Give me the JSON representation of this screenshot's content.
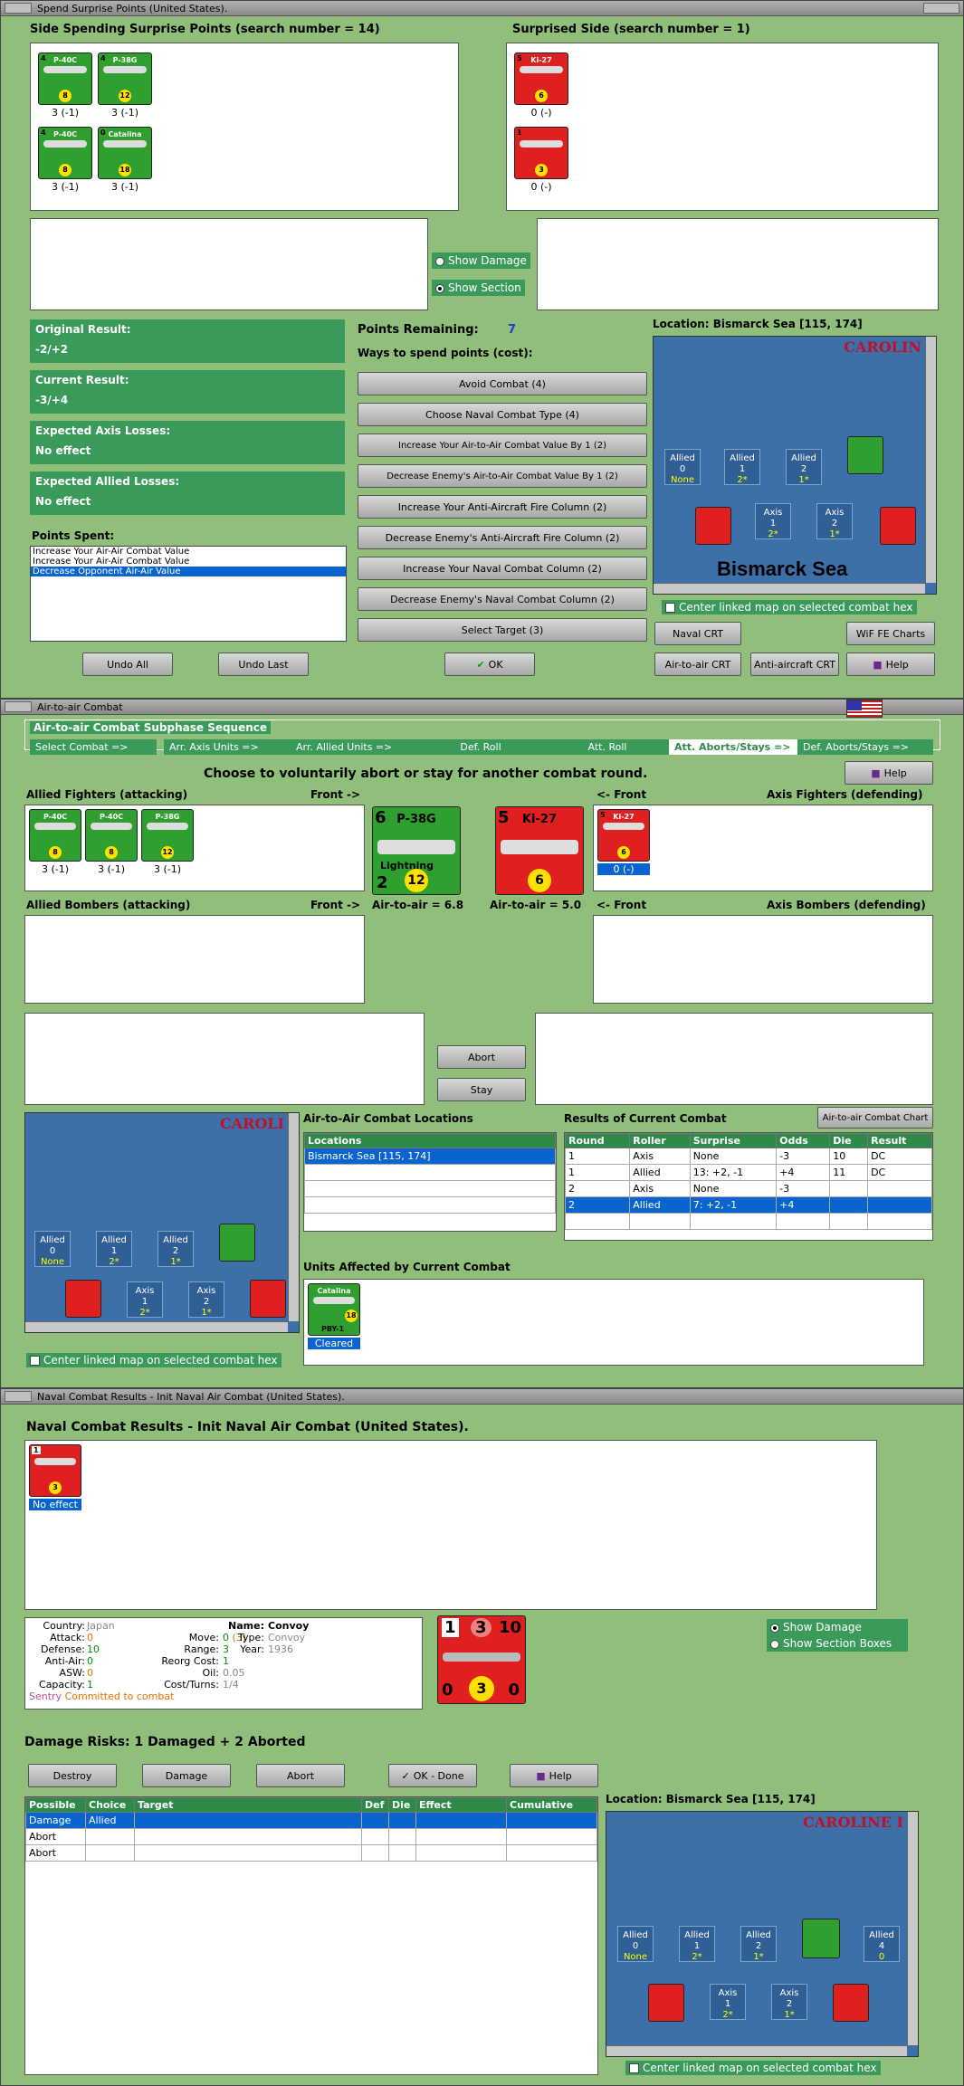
{
  "win1": {
    "title": "Spend Surprise Points (United States).",
    "side_header": "Side Spending Surprise Points (search number = 14)",
    "surprised_header": "Surprised Side (search number = 1)",
    "allied_counters": [
      {
        "name": "P-40C",
        "top": "4",
        "str": "8",
        "cap": "3 (-1)"
      },
      {
        "name": "P-38G",
        "top": "4",
        "str": "12",
        "cap": "3 (-1)"
      },
      {
        "name": "P-40C",
        "top": "4",
        "str": "8",
        "cap": "3 (-1)"
      },
      {
        "name": "Catalina",
        "top": "0",
        "str": "18",
        "cap": "3 (-1)"
      }
    ],
    "axis_counters": [
      {
        "name": "Ki-27",
        "top": "5",
        "str": "6",
        "cap": "0 (-)"
      },
      {
        "name": "",
        "top": "1",
        "str": "3",
        "cap": "0 (-)"
      }
    ],
    "show_damage": "Show Damage",
    "show_section": "Show Section",
    "original_result_label": "Original Result:",
    "original_result": "-2/+2",
    "current_result_label": "Current Result:",
    "current_result": "-3/+4",
    "axis_losses_label": "Expected Axis Losses:",
    "axis_losses": "No effect",
    "allied_losses_label": "Expected Allied Losses:",
    "allied_losses": "No effect",
    "points_spent_label": "Points Spent:",
    "points_spent": [
      "Increase Your Air-Air Combat Value",
      "Increase Your Air-Air Combat Value",
      "Decrease Opponent Air-Air Value"
    ],
    "points_remaining_label": "Points Remaining:",
    "points_remaining": "7",
    "ways_label": "Ways to spend points (cost):",
    "options": [
      "Avoid Combat (4)",
      "Choose Naval Combat Type (4)",
      "Increase Your Air-to-Air Combat Value By 1 (2)",
      "Decrease Enemy's Air-to-Air Combat Value By 1 (2)",
      "Increase Your Anti-Aircraft Fire Column (2)",
      "Decrease Enemy's Anti-Aircraft Fire Column (2)",
      "Increase Your Naval Combat Column (2)",
      "Decrease Enemy's Naval Combat Column (2)",
      "Select Target (3)"
    ],
    "location": "Location: Bismarck Sea [115, 174]",
    "map_caroline": "CAROLIN",
    "map_sea": "Bismarck Sea",
    "center_map": "Center linked map on selected combat hex",
    "undo_all": "Undo All",
    "undo_last": "Undo Last",
    "ok": "OK",
    "naval_crt": "Naval CRT",
    "wif_fe": "WiF FE Charts",
    "air_crt": "Air-to-air CRT",
    "aa_crt": "Anti-aircraft CRT",
    "help": "Help"
  },
  "map_hexes": [
    {
      "t": "Allied",
      "n": "0",
      "s": "None"
    },
    {
      "t": "Allied",
      "n": "1",
      "s": "2*"
    },
    {
      "t": "Allied",
      "n": "2",
      "s": "1*"
    },
    {
      "t": "Axis",
      "n": "1",
      "s": "2*"
    },
    {
      "t": "Axis",
      "n": "2",
      "s": "1*"
    }
  ],
  "win2": {
    "title": "Air-to-air Combat",
    "group": "Air-to-air Combat Subphase Sequence",
    "steps": [
      "Select Combat =>",
      "Arr. Axis Units =>",
      "Arr. Allied Units =>",
      "Def. Roll",
      "Att. Roll",
      "Att. Aborts/Stays =>",
      "Def. Aborts/Stays =>"
    ],
    "prompt": "Choose to voluntarily abort or stay for another combat round.",
    "help": "Help",
    "allied_fighters": "Allied Fighters (attacking)",
    "front_r": "Front ->",
    "front_l": "<- Front",
    "axis_fighters": "Axis Fighters (defending)",
    "allied_bombers": "Allied Bombers (attacking)",
    "axis_bombers": "Axis Bombers (defending)",
    "fighter_counters": [
      {
        "name": "P-40C",
        "str": "8",
        "cap": "3 (-1)"
      },
      {
        "name": "P-40C",
        "str": "8",
        "cap": "3 (-1)"
      },
      {
        "name": "P-38G",
        "str": "12",
        "cap": "3 (-1)"
      }
    ],
    "big_allied": {
      "top": "6",
      "name": "P-38G",
      "sub": "Lightning",
      "bot": "2",
      "str": "12"
    },
    "big_axis": {
      "top": "5",
      "name": "Ki-27",
      "str": "6"
    },
    "axis_small": {
      "name": "Ki-27",
      "top": "5",
      "str": "6",
      "cap": "0 (-)"
    },
    "aa_allied": "Air-to-air = 6.8",
    "aa_axis": "Air-to-air = 5.0",
    "abort": "Abort",
    "stay": "Stay",
    "map_caroline": "CAROLI",
    "locations_label": "Air-to-Air Combat Locations",
    "locations_header": "Locations",
    "locations": [
      "Bismarck Sea [115, 174]"
    ],
    "results_label": "Results of Current Combat",
    "chart_btn": "Air-to-air Combat Chart",
    "results_headers": [
      "Round",
      "Roller",
      "Surprise",
      "Odds",
      "Die",
      "Result"
    ],
    "results": [
      [
        "1",
        "Axis",
        "None",
        "-3",
        "10",
        "DC"
      ],
      [
        "1",
        "Allied",
        "13: +2, -1",
        "+4",
        "11",
        "DC"
      ],
      [
        "2",
        "Axis",
        "None",
        "-3",
        "",
        ""
      ],
      [
        "2",
        "Allied",
        "7: +2, -1",
        "+4",
        "",
        ""
      ]
    ],
    "affected_label": "Units Affected by Current Combat",
    "affected_unit": {
      "name": "Catalina",
      "str": "18",
      "sub": "PBY-1",
      "status": "Cleared"
    },
    "center_map": "Center linked map on selected combat hex"
  },
  "win3": {
    "title": "Naval Combat Results - Init Naval Air Combat (United States).",
    "header": "Naval Combat Results - Init Naval Air Combat (United States).",
    "unit_status": "No effect",
    "info": {
      "country_l": "Country:",
      "country": "Japan",
      "attack_l": "Attack:",
      "attack": "0",
      "defense_l": "Defense:",
      "defense": "10",
      "anti_air_l": "Anti-Air:",
      "anti_air": "0",
      "asw_l": "ASW:",
      "asw": "0",
      "capacity_l": "Capacity:",
      "capacity": "1",
      "sentry": "Sentry",
      "committed": "Committed to combat",
      "move_l": "Move:",
      "move": "0",
      "move_b": "(3)",
      "range_l": "Range:",
      "range": "3",
      "reorg_l": "Reorg Cost:",
      "reorg": "1",
      "oil_l": "Oil:",
      "oil": "0.05",
      "cost_l": "Cost/Turns:",
      "cost": "1/4",
      "name_l": "Name:",
      "name": "Convoy",
      "type_l": "Type:",
      "type": "Convoy",
      "year_l": "Year:",
      "year": "1936"
    },
    "big_counter": {
      "a": "1",
      "b": "3",
      "c": "10",
      "d": "0",
      "e": "3",
      "f": "0"
    },
    "show_damage": "Show Damage",
    "show_section": "Show Section Boxes",
    "damage_risks": "Damage Risks: 1 Damaged + 2 Aborted",
    "destroy": "Destroy",
    "damage": "Damage",
    "abort": "Abort",
    "ok_done": "OK - Done",
    "help": "Help",
    "table_headers": [
      "Possible",
      "Choice",
      "Target",
      "Def",
      "Die",
      "Effect",
      "Cumulative"
    ],
    "rows": [
      [
        "Damage",
        "Allied",
        "",
        "",
        "",
        "",
        ""
      ],
      [
        "Abort",
        "",
        "",
        "",
        "",
        "",
        ""
      ],
      [
        "Abort",
        "",
        "",
        "",
        "",
        "",
        ""
      ]
    ],
    "location": "Location:  Bismarck Sea [115, 174]",
    "map_caroline": "CAROLINE I",
    "extra_hex": {
      "t": "Allied",
      "n": "4",
      "s": "0"
    },
    "center_map": "Center linked map on selected combat hex"
  }
}
